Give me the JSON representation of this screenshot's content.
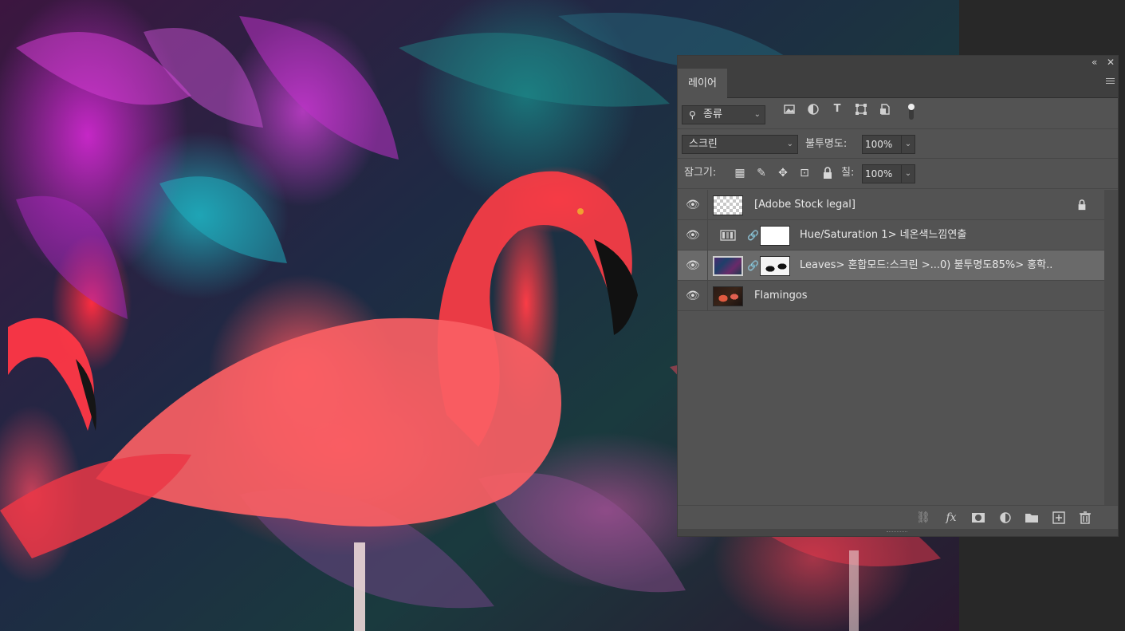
{
  "panel": {
    "tab_label": "레이어",
    "collapse_glyph": "«",
    "close_glyph": "✕",
    "filter": {
      "kind_label": "종류",
      "icons": [
        "image-filter-icon",
        "adjustment-filter-icon",
        "type-filter-icon",
        "shape-filter-icon",
        "smart-object-filter-icon"
      ]
    },
    "blend": {
      "mode": "스크린",
      "opacity_label": "불투명도:",
      "opacity_value": "100%"
    },
    "lock": {
      "label": "잠그기:",
      "fill_label": "칠:",
      "fill_value": "100%"
    }
  },
  "layers": [
    {
      "name": "[Adobe Stock legal]",
      "visible": true,
      "locked": true,
      "thumb": "transparent"
    },
    {
      "name": "Hue/Saturation 1> 네온색느낌연출",
      "visible": true,
      "type": "adjustment",
      "has_mask": true
    },
    {
      "name": "Leaves> 혼합모드:스크린 >...0) 불투명도85%> 홍학..",
      "visible": true,
      "selected": true,
      "has_mask": true
    },
    {
      "name": "Flamingos",
      "visible": true
    }
  ],
  "colors": {
    "panel_bg": "#535353",
    "panel_header": "#3f3f3f",
    "selected_layer": "#6a6a6a",
    "app_bg": "#282828"
  }
}
